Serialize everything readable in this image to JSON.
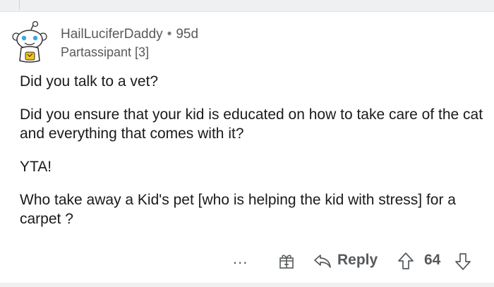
{
  "comment": {
    "author": "HailLuciferDaddy",
    "separator": "•",
    "age": "95d",
    "flair": "Partassipant [3]",
    "paragraphs": [
      "Did you talk to a vet?",
      "Did you ensure that your kid is educated on how to take care of the cat and everything that comes with it?",
      "YTA!",
      "Who take away a Kid's pet [who is helping the kid with stress]  for a carpet ?"
    ]
  },
  "actions": {
    "more_label": "...",
    "reply_label": "Reply",
    "score": "64"
  },
  "icons": {
    "avatar": "snoo-avatar",
    "gift": "gift-icon",
    "reply": "reply-arrow-icon",
    "upvote": "upvote-arrow-icon",
    "downvote": "downvote-arrow-icon"
  },
  "colors": {
    "text": "#1a1a1b",
    "meta": "#56595c",
    "band": "#eef0f2"
  }
}
